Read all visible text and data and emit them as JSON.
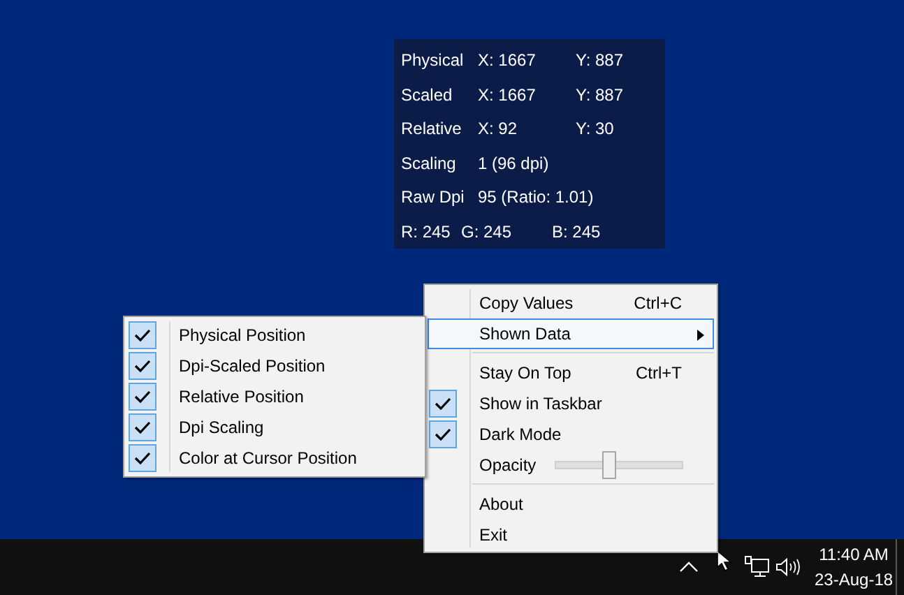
{
  "info_panel": {
    "rows": [
      {
        "kind": "coords",
        "label": "Physical",
        "x": "X: 1667",
        "y": "Y: 887"
      },
      {
        "kind": "coords",
        "label": "Scaled",
        "x": "X: 1667",
        "y": "Y: 887"
      },
      {
        "kind": "coords",
        "label": "Relative",
        "x": "X: 92",
        "y": "Y: 30"
      },
      {
        "kind": "value",
        "label": "Scaling",
        "value": "1 (96 dpi)"
      },
      {
        "kind": "value",
        "label": "Raw Dpi",
        "value": "95  (Ratio: 1.01)"
      },
      {
        "kind": "rgb",
        "r": "R: 245",
        "g": "G: 245",
        "b": "B: 245"
      }
    ]
  },
  "context_menu": {
    "items": [
      {
        "kind": "item",
        "label": "Copy Values",
        "shortcut": "Ctrl+C",
        "checked": false,
        "selected": false,
        "submenu": false
      },
      {
        "kind": "item",
        "label": "Shown Data",
        "checked": false,
        "selected": true,
        "submenu": true
      },
      {
        "kind": "separator"
      },
      {
        "kind": "item",
        "label": "Stay On Top",
        "shortcut": "Ctrl+T",
        "checked": false,
        "selected": false,
        "submenu": false
      },
      {
        "kind": "item",
        "label": "Show in Taskbar",
        "checked": true,
        "selected": false,
        "submenu": false
      },
      {
        "kind": "item",
        "label": "Dark Mode",
        "checked": true,
        "selected": false,
        "submenu": false
      },
      {
        "kind": "slider",
        "label": "Opacity",
        "level": 0.43
      },
      {
        "kind": "separator"
      },
      {
        "kind": "item",
        "label": "About",
        "checked": false,
        "selected": false,
        "submenu": false
      },
      {
        "kind": "item",
        "label": "Exit",
        "checked": false,
        "selected": false,
        "submenu": false
      }
    ]
  },
  "submenu": {
    "items": [
      {
        "label": "Physical Position",
        "checked": true
      },
      {
        "label": "Dpi-Scaled Position",
        "checked": true
      },
      {
        "label": "Relative Position",
        "checked": true
      },
      {
        "label": "Dpi Scaling",
        "checked": true
      },
      {
        "label": "Color at Cursor Position",
        "checked": true
      }
    ]
  },
  "taskbar": {
    "time": "11:40 AM",
    "date": "23-Aug-18"
  }
}
